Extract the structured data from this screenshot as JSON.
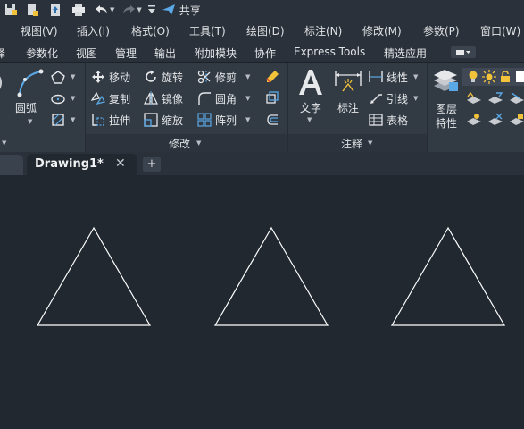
{
  "quick_access": {
    "share_label": "共享",
    "icons": [
      "save-as-icon",
      "export-icon",
      "upload-icon",
      "print-icon",
      "undo-icon",
      "redo-icon",
      "customize-icon",
      "share-icon"
    ]
  },
  "menubar": {
    "items": [
      "视图(V)",
      "插入(I)",
      "格式(O)",
      "工具(T)",
      "绘图(D)",
      "标注(N)",
      "修改(M)",
      "参数(P)",
      "窗口(W)"
    ]
  },
  "ribbon_tabs": {
    "items": [
      "译",
      "参数化",
      "视图",
      "管理",
      "输出",
      "附加模块",
      "协作",
      "Express Tools",
      "精选应用"
    ]
  },
  "ribbon": {
    "draw": {
      "arc_label": "圆弧"
    },
    "modify": {
      "title": "修改",
      "move": "移动",
      "rotate": "旋转",
      "trim": "修剪",
      "copy": "复制",
      "mirror": "镜像",
      "fillet": "圆角",
      "stretch": "拉伸",
      "scale": "缩放",
      "array": "阵列"
    },
    "annotation": {
      "title": "注释",
      "text": "文字",
      "dimension": "标注",
      "linear": "线性",
      "leader": "引线",
      "table": "表格"
    },
    "layers": {
      "layer_properties_line1": "图层",
      "layer_properties_line2": "特性"
    }
  },
  "filetabs": {
    "active": "Drawing1*",
    "close_symbol": "✕",
    "new_symbol": "+"
  },
  "colors": {
    "background": "#212830",
    "ribbon": "#323a44",
    "accent_blue": "#5aa9e6",
    "accent_yellow": "#f2c23a",
    "triangle_stroke": "#ffffff"
  }
}
